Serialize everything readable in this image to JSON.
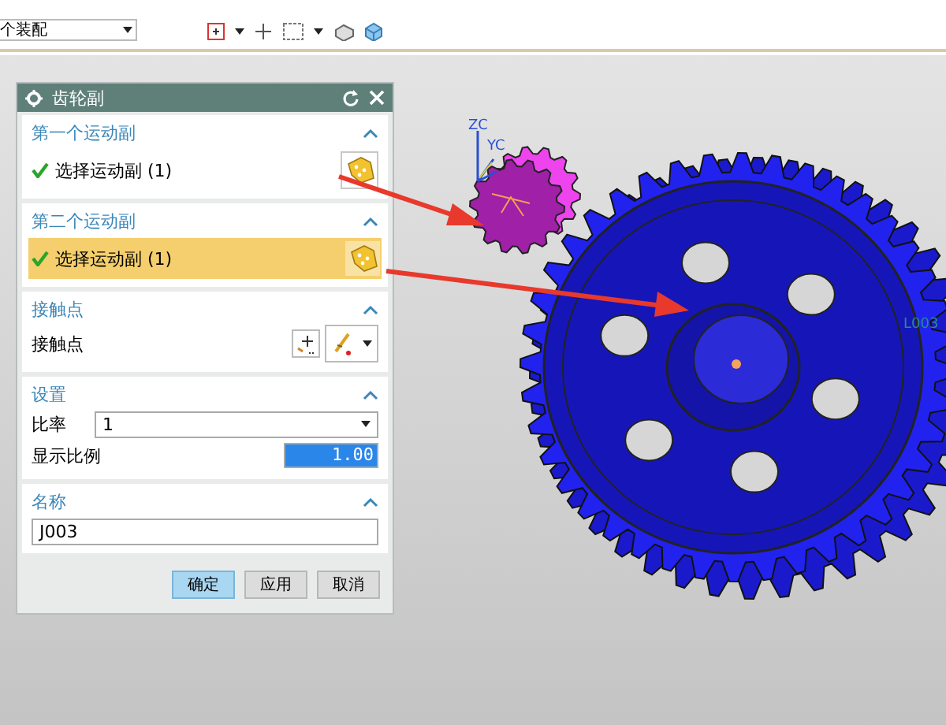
{
  "toolbar": {
    "assembly_dropdown": "个装配"
  },
  "dialog": {
    "title": "齿轮副",
    "sections": [
      {
        "kind": "selection",
        "title": "第一个运动副",
        "expanded": true,
        "label": "选择运动副 (1)",
        "complete": true,
        "selected": false
      },
      {
        "kind": "selection",
        "title": "第二个运动副",
        "expanded": true,
        "label": "选择运动副 (1)",
        "complete": true,
        "selected": true
      },
      {
        "kind": "point",
        "title": "接触点",
        "expanded": true,
        "label": "接触点"
      },
      {
        "kind": "settings",
        "title": "设置",
        "expanded": true,
        "ratio_label": "比率",
        "ratio_value": "1",
        "display_label": "显示比例",
        "display_value": "1.00",
        "display_value_highlighted": true
      },
      {
        "kind": "name",
        "title": "名称",
        "expanded": true,
        "value": "J003"
      }
    ],
    "buttons": [
      {
        "label": "确定",
        "default": true
      },
      {
        "label": "应用",
        "default": false
      },
      {
        "label": "取消",
        "default": false
      }
    ]
  },
  "viewport": {
    "axis_labels": [
      "ZC",
      "YC"
    ],
    "part_label": "L003"
  }
}
